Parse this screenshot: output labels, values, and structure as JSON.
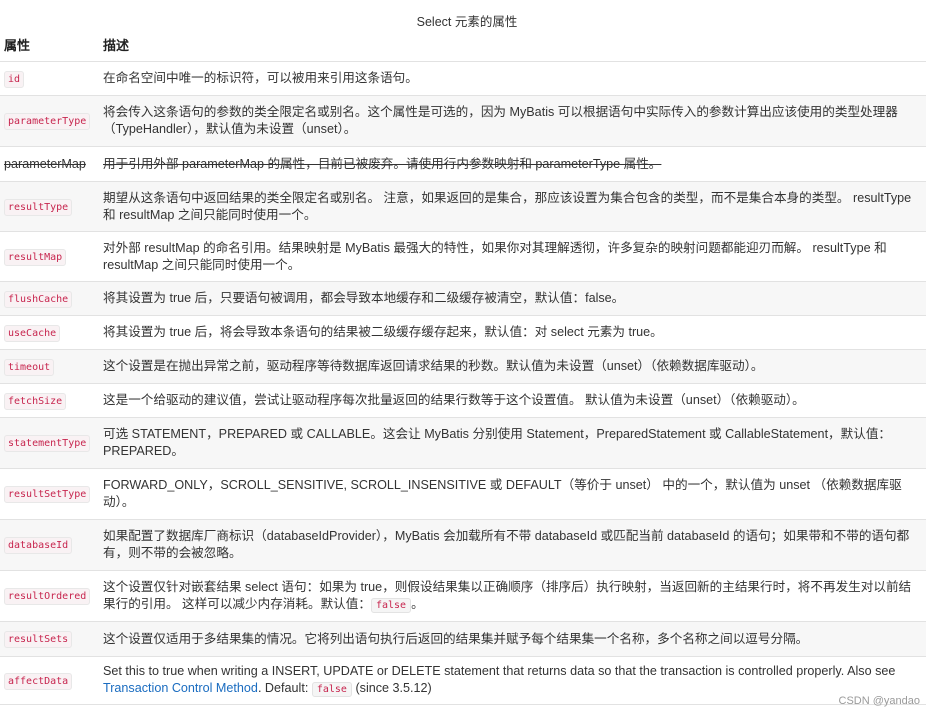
{
  "caption": "Select 元素的属性",
  "headers": {
    "attr": "属性",
    "desc": "描述"
  },
  "rows": {
    "id": {
      "name": "id",
      "desc": "在命名空间中唯一的标识符，可以被用来引用这条语句。"
    },
    "parameterType": {
      "name": "parameterType",
      "desc": "将会传入这条语句的参数的类全限定名或别名。这个属性是可选的，因为 MyBatis 可以根据语句中实际传入的参数计算出应该使用的类型处理器（TypeHandler），默认值为未设置（unset）。"
    },
    "parameterMap": {
      "name": "parameterMap",
      "desc": "用于引用外部 parameterMap 的属性，目前已被废弃。请使用行内参数映射和 parameterType 属性。"
    },
    "resultType": {
      "name": "resultType",
      "desc": "期望从这条语句中返回结果的类全限定名或别名。 注意，如果返回的是集合，那应该设置为集合包含的类型，而不是集合本身的类型。 resultType 和 resultMap 之间只能同时使用一个。"
    },
    "resultMap": {
      "name": "resultMap",
      "desc": "对外部 resultMap 的命名引用。结果映射是 MyBatis 最强大的特性，如果你对其理解透彻，许多复杂的映射问题都能迎刃而解。 resultType 和 resultMap 之间只能同时使用一个。"
    },
    "flushCache": {
      "name": "flushCache",
      "desc": "将其设置为 true 后，只要语句被调用，都会导致本地缓存和二级缓存被清空，默认值：false。"
    },
    "useCache": {
      "name": "useCache",
      "desc": "将其设置为 true 后，将会导致本条语句的结果被二级缓存缓存起来，默认值：对 select 元素为 true。"
    },
    "timeout": {
      "name": "timeout",
      "desc": "这个设置是在抛出异常之前，驱动程序等待数据库返回请求结果的秒数。默认值为未设置（unset）（依赖数据库驱动）。"
    },
    "fetchSize": {
      "name": "fetchSize",
      "desc": "这是一个给驱动的建议值，尝试让驱动程序每次批量返回的结果行数等于这个设置值。 默认值为未设置（unset）（依赖驱动）。"
    },
    "statementType": {
      "name": "statementType",
      "desc": "可选 STATEMENT，PREPARED 或 CALLABLE。这会让 MyBatis 分别使用 Statement，PreparedStatement 或 CallableStatement，默认值：PREPARED。"
    },
    "resultSetType": {
      "name": "resultSetType",
      "desc": "FORWARD_ONLY，SCROLL_SENSITIVE, SCROLL_INSENSITIVE 或 DEFAULT（等价于 unset） 中的一个，默认值为 unset （依赖数据库驱动）。"
    },
    "databaseId": {
      "name": "databaseId",
      "desc": "如果配置了数据库厂商标识（databaseIdProvider），MyBatis 会加载所有不带 databaseId 或匹配当前 databaseId 的语句；如果带和不带的语句都有，则不带的会被忽略。"
    },
    "resultOrdered": {
      "name": "resultOrdered",
      "desc_before": "这个设置仅针对嵌套结果 select 语句：如果为 true，则假设结果集以正确顺序（排序后）执行映射，当返回新的主结果行时，将不再发生对以前结果行的引用。 这样可以减少内存消耗。默认值：",
      "desc_code": "false",
      "desc_after": "。"
    },
    "resultSets": {
      "name": "resultSets",
      "desc": "这个设置仅适用于多结果集的情况。它将列出语句执行后返回的结果集并赋予每个结果集一个名称，多个名称之间以逗号分隔。"
    },
    "affectData": {
      "name": "affectData",
      "desc_before": "Set this to true when writing a INSERT, UPDATE or DELETE statement that returns data so that the transaction is controlled properly. Also see ",
      "link": "Transaction Control Method",
      "desc_mid": ". Default: ",
      "desc_code": "false",
      "desc_after": " (since 3.5.12)"
    }
  },
  "watermark": "CSDN @yandao"
}
